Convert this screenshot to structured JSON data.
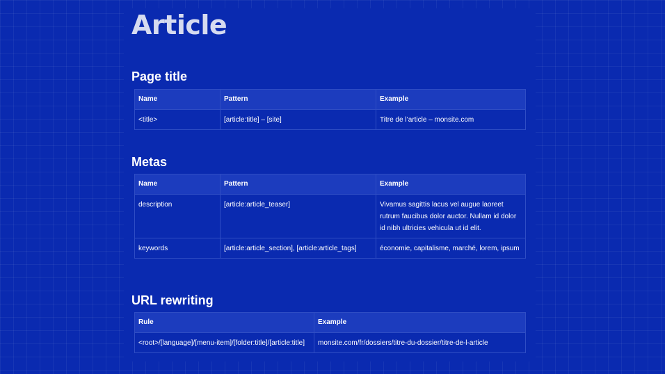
{
  "page": {
    "title": "Article"
  },
  "sections": {
    "page_title": {
      "heading": "Page title",
      "headers": [
        "Name",
        "Pattern",
        "Example"
      ],
      "rows": [
        [
          "<title>",
          "[article:title] – [site]",
          "Titre de l’article – monsite.com"
        ]
      ]
    },
    "metas": {
      "heading": "Metas",
      "headers": [
        "Name",
        "Pattern",
        "Example"
      ],
      "rows": [
        [
          "description",
          "[article:article_teaser]",
          "Vivamus sagittis lacus vel augue laoreet rutrum faucibus dolor auctor. Nullam id dolor id nibh ultricies vehicula ut id elit."
        ],
        [
          "keywords",
          "[article:article_section], [article:article_tags]",
          "économie, capitalisme, marché, lorem, ipsum"
        ]
      ]
    },
    "url_rewriting": {
      "heading": "URL rewriting",
      "headers": [
        "Rule",
        "Example"
      ],
      "rows": [
        [
          "<root>/[language]/[menu-item]/[folder:title]/[article:title]",
          "monsite.com/fr/dossiers/titre-du-dossier/titre-de-l-article"
        ]
      ]
    }
  },
  "colors": {
    "background": "#0a2ab0",
    "header_cell": "#1c3cbe",
    "border": "#2f4dc4",
    "title_text": "#d6dbf0"
  }
}
